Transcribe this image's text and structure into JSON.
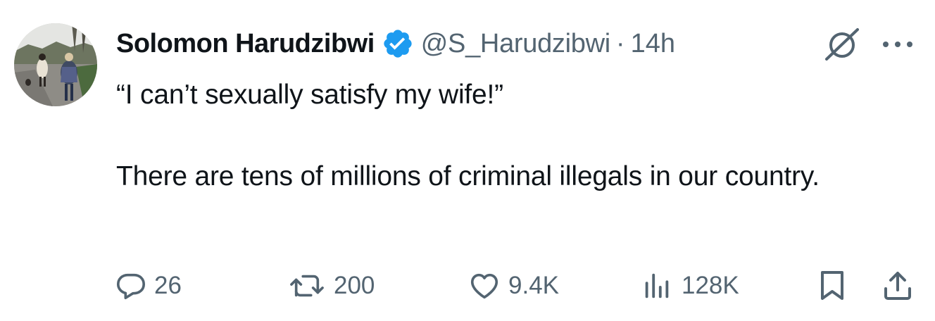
{
  "author": {
    "name": "Solomon Harudzibwi",
    "handle": "@S_Harudzibwi",
    "separator": "·",
    "time": "14h",
    "verified": true
  },
  "tweet": {
    "line1": "“I can’t sexually satisfy my wife!”",
    "line2": "There are tens of millions of criminal illegals in our country."
  },
  "metrics": {
    "replies": "26",
    "retweets": "200",
    "likes": "9.4K",
    "views": "128K"
  },
  "icons": {
    "verified": "verified-badge-icon",
    "grok": "grok-icon",
    "more": "more-icon",
    "reply": "reply-icon",
    "retweet": "retweet-icon",
    "like": "heart-icon",
    "views": "views-icon",
    "bookmark": "bookmark-icon",
    "share": "share-icon"
  },
  "colors": {
    "text": "#0f1419",
    "secondary": "#536471",
    "verified": "#1d9bf0"
  }
}
